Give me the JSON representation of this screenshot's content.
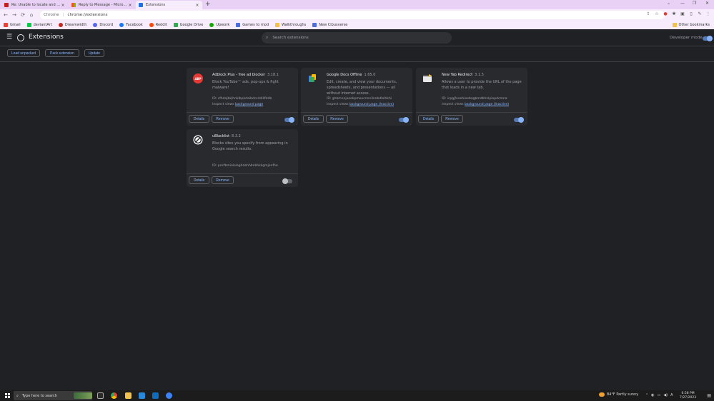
{
  "tabs": [
    {
      "title": "Re: Unable to locate and uninstall",
      "close": "×",
      "favicon_color": "#c5221f"
    },
    {
      "title": "Reply to Message - Microsoft Co",
      "close": "×",
      "favicon_color": "#f25022"
    },
    {
      "title": "Extensions",
      "close": "×",
      "favicon_color": "#1a73e8"
    }
  ],
  "new_tab": "+",
  "window_controls": {
    "chevron": "⌄",
    "minimize": "—",
    "restore": "❐",
    "close": "✕"
  },
  "toolbar": {
    "back": "←",
    "forward": "→",
    "reload": "⟳",
    "home": "⌂",
    "site_chip": "Chrome",
    "separator": "|",
    "url": "chrome://extensions",
    "icons": [
      "share-icon",
      "star-icon",
      "adblock-icon",
      "extensions-puzzle-icon",
      "extension-icon",
      "sidepanel-icon",
      "profile-icon",
      "menu-icon"
    ],
    "icon_glyphs": [
      "⇪",
      "☆",
      "●",
      "✱",
      "▣",
      "▯",
      "✎",
      "⋮"
    ]
  },
  "bookmarks": [
    {
      "label": "Gmail",
      "color": "#ea4335"
    },
    {
      "label": "deviantArt",
      "color": "#05cc47"
    },
    {
      "label": "Dreamwidth",
      "color": "#c4291f"
    },
    {
      "label": "Discord",
      "color": "#5865f2"
    },
    {
      "label": "Facebook",
      "color": "#1877f2"
    },
    {
      "label": "Reddit",
      "color": "#ff4500"
    },
    {
      "label": "Google Drive",
      "color": "#34a853"
    },
    {
      "label": "Upwork",
      "color": "#14a800"
    },
    {
      "label": "Games to mod",
      "color": "#4a6ee0"
    },
    {
      "label": "Walkthroughs",
      "color": "#f0c24b"
    },
    {
      "label": "New Cibusverse",
      "color": "#4a6ee0"
    }
  ],
  "other_bookmarks": "Other bookmarks",
  "header": {
    "menu": "☰",
    "title": "Extensions",
    "search_placeholder": "Search extensions",
    "search_glyph": "⌕",
    "developer_mode_label": "Developer mode",
    "developer_mode_on": true
  },
  "actions": {
    "load_unpacked": "Load unpacked",
    "pack_extension": "Pack extension",
    "update": "Update"
  },
  "extensions": [
    {
      "name": "Adblock Plus - free ad blocker",
      "version": "3.18.1",
      "description": "Block YouTube™ ads, pop-ups & fight malware!",
      "id": "ID: cfhdojbkjhnklbpkdaibdccddilifddb",
      "inspect_label": "Inspect views",
      "inspect_link": "background page",
      "details": "Details",
      "remove": "Remove",
      "enabled": true,
      "icon": "abp-icon",
      "icon_text": "ABP"
    },
    {
      "name": "Google Docs Offline",
      "version": "1.65.0",
      "description": "Edit, create, and view your documents, spreadsheets, and presentations — all without internet access.",
      "id": "ID: ghbmnnjooekpmoecnnnilnnbdlolhkhi",
      "inspect_label": "Inspect views",
      "inspect_link": "background page (Inactive)",
      "details": "Details",
      "remove": "Remove",
      "enabled": true,
      "icon": "google-docs-icon",
      "icon_text": ""
    },
    {
      "name": "New Tab Redirect",
      "version": "3.1.5",
      "description": "Allows a user to provide the URL of the page that loads in a new tab.",
      "id": "ID: icpgjfneehieebagbmdbhnlpiopdcmna",
      "inspect_label": "Inspect views",
      "inspect_link": "background page (Inactive)",
      "details": "Details",
      "remove": "Remove",
      "enabled": true,
      "icon": "new-tab-redirect-icon",
      "icon_text": ""
    },
    {
      "name": "uBlacklist",
      "version": "8.3.2",
      "description": "Blocks sites you specify from appearing in Google search results.",
      "id": "ID: pncfbmialoiaghdehhbnbhkkgmjanfhe",
      "inspect_label": "",
      "inspect_link": "",
      "details": "Details",
      "remove": "Remove",
      "enabled": false,
      "icon": "ublacklist-icon",
      "icon_text": ""
    }
  ],
  "taskbar": {
    "search_placeholder": "Type here to search",
    "search_glyph": "⌕",
    "weather": "84°F  Partly sunny",
    "time": "6:58 PM",
    "date": "7/27/2023",
    "tray_glyphs": [
      "⌃",
      "◐",
      "▭",
      "◀)",
      "A"
    ],
    "notifications_glyph": "▤"
  }
}
